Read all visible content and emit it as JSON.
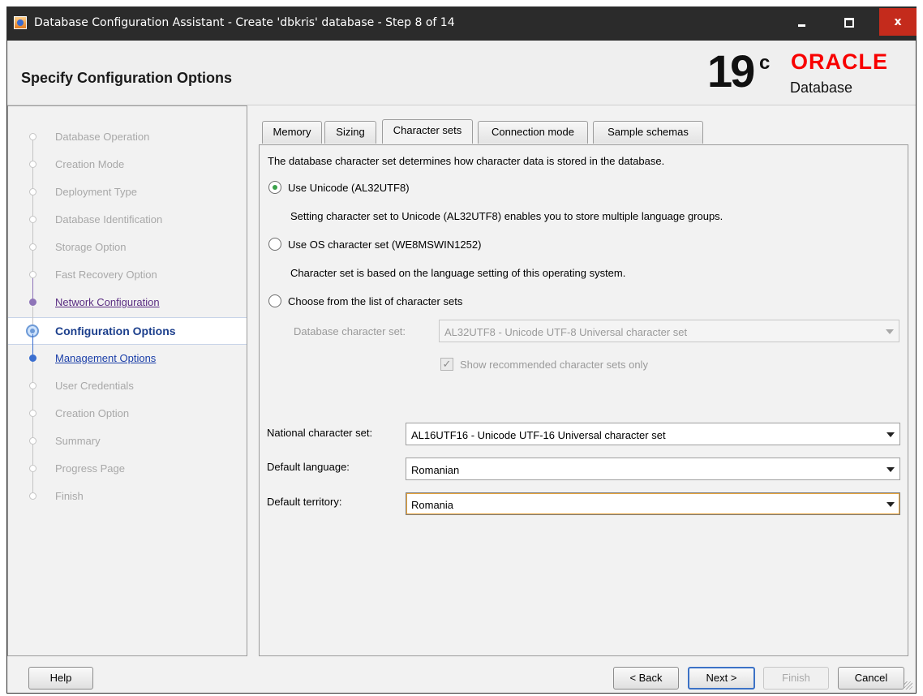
{
  "window": {
    "title": "Database Configuration Assistant - Create 'dbkris' database - Step 8 of 14"
  },
  "header": {
    "page_title": "Specify Configuration Options",
    "logo_version": "19",
    "logo_superscript": "c",
    "logo_brand": "ORACLE",
    "logo_product": "Database"
  },
  "steps": [
    {
      "label": "Database Operation",
      "state": "done"
    },
    {
      "label": "Creation Mode",
      "state": "done"
    },
    {
      "label": "Deployment Type",
      "state": "done"
    },
    {
      "label": "Database Identification",
      "state": "done"
    },
    {
      "label": "Storage Option",
      "state": "done"
    },
    {
      "label": "Fast Recovery Option",
      "state": "done"
    },
    {
      "label": "Network Configuration",
      "state": "visited"
    },
    {
      "label": "Configuration Options",
      "state": "current"
    },
    {
      "label": "Management Options",
      "state": "link"
    },
    {
      "label": "User Credentials",
      "state": "pending"
    },
    {
      "label": "Creation Option",
      "state": "pending"
    },
    {
      "label": "Summary",
      "state": "pending"
    },
    {
      "label": "Progress Page",
      "state": "pending"
    },
    {
      "label": "Finish",
      "state": "pending"
    }
  ],
  "tabs": [
    {
      "label": "Memory",
      "active": false
    },
    {
      "label": "Sizing",
      "active": false
    },
    {
      "label": "Character sets",
      "active": true
    },
    {
      "label": "Connection mode",
      "active": false
    },
    {
      "label": "Sample schemas",
      "active": false
    }
  ],
  "charset": {
    "intro": "The database character set determines how character data is stored in the database.",
    "opt_unicode": "Use Unicode (AL32UTF8)",
    "opt_unicode_desc": "Setting character set to Unicode (AL32UTF8) enables you to store multiple language groups.",
    "opt_os": "Use OS character set (WE8MSWIN1252)",
    "opt_os_desc": "Character set is based on the language setting of this operating system.",
    "opt_list": "Choose from the list of character sets",
    "db_charset_label": "Database character set:",
    "db_charset_value": "AL32UTF8 - Unicode UTF-8 Universal character set",
    "recommended_label": "Show recommended character sets only",
    "selected_option": "unicode"
  },
  "nls": {
    "national_label": "National character set:",
    "national_value": "AL16UTF16 - Unicode UTF-16 Universal character set",
    "language_label": "Default language:",
    "language_value": "Romanian",
    "territory_label": "Default territory:",
    "territory_value": "Romania"
  },
  "footer": {
    "help": "Help",
    "back": "< Back",
    "next": "Next >",
    "finish": "Finish",
    "cancel": "Cancel"
  },
  "colors": {
    "oracle_red": "#f80000",
    "current_step": "#1c3f8c",
    "link_step": "#1a3ea8",
    "visited_step": "#5a2d82",
    "close_button": "#c42b1c"
  }
}
